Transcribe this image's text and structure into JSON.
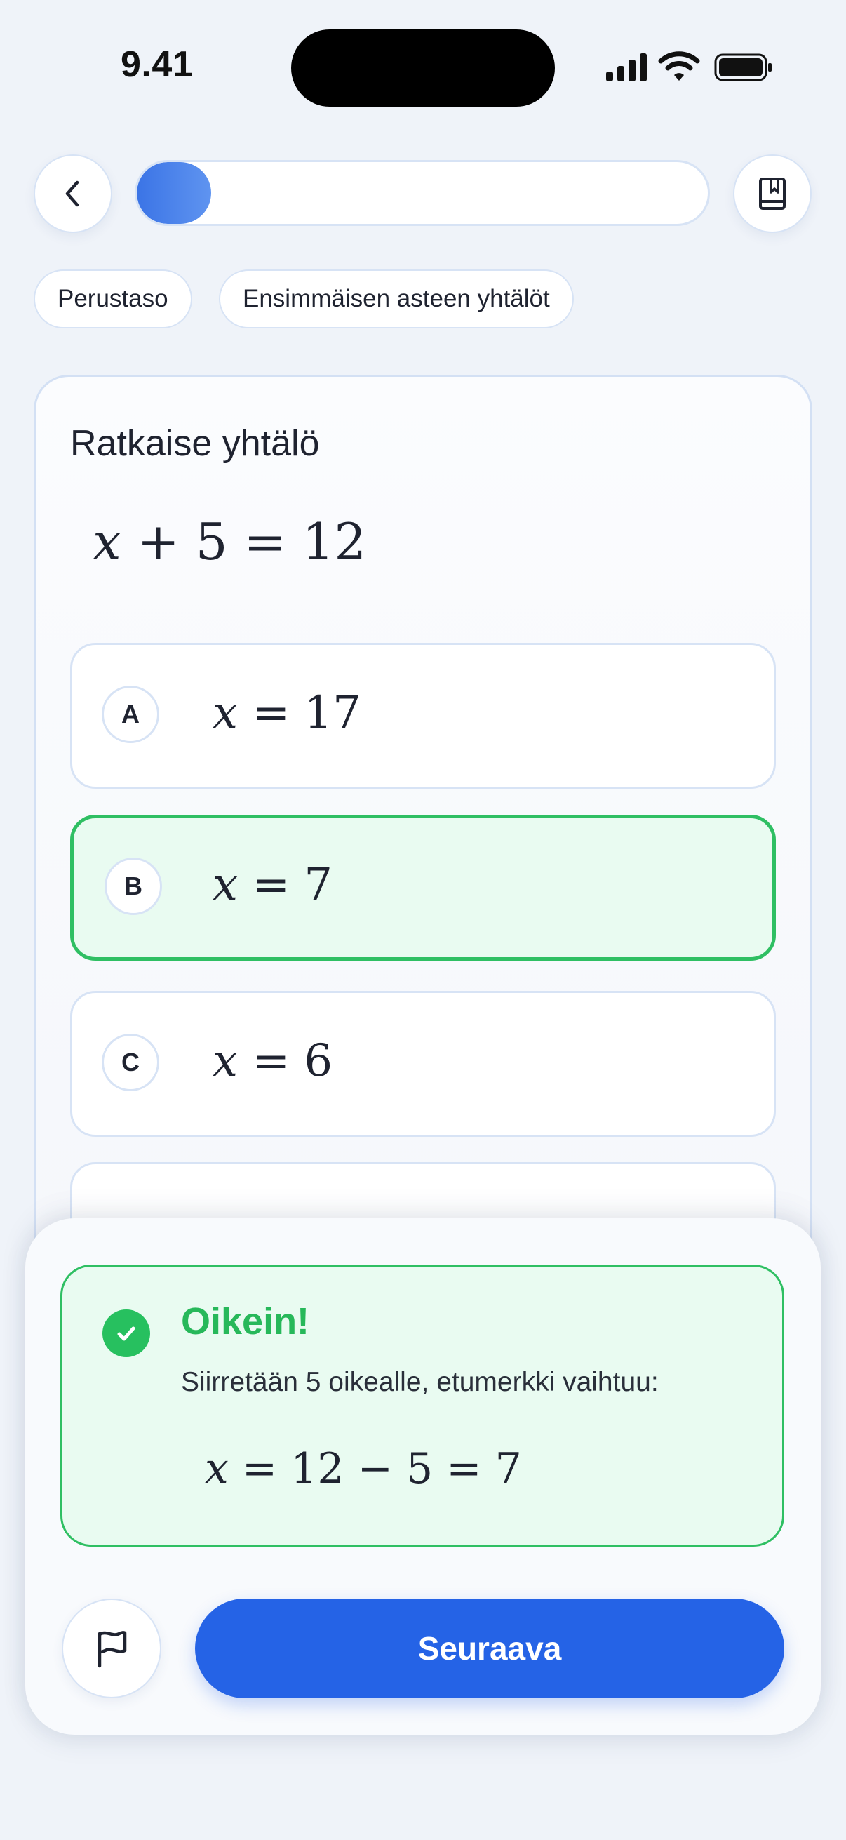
{
  "status_bar": {
    "time": "9.41",
    "icons": [
      "cellular-signal-icon",
      "wifi-icon",
      "battery-icon"
    ]
  },
  "header": {
    "back_icon": "chevron-left-icon",
    "bookmark_icon": "book-icon",
    "progress": 0.13
  },
  "chips": {
    "level": "Perustaso",
    "topic": "Ensimmäisen asteen yhtälöt"
  },
  "question": {
    "prompt": "Ratkaise yhtälö",
    "equation": {
      "var": "x",
      "rest": " + 5 = 12"
    }
  },
  "options": [
    {
      "letter": "A",
      "var": "x",
      "rest": " = 17",
      "state": "default"
    },
    {
      "letter": "B",
      "var": "x",
      "rest": " = 7",
      "state": "correct"
    },
    {
      "letter": "C",
      "var": "x",
      "rest": " = 6",
      "state": "default"
    }
  ],
  "feedback": {
    "icon": "check-circle-icon",
    "title": "Oikein!",
    "text": "Siirretään 5 oikealle, etumerkki vaihtuu:",
    "math": {
      "var": "x",
      "rest": " = 12 − 5 = 7"
    }
  },
  "actions": {
    "flag_icon": "flag-icon",
    "next_label": "Seuraava"
  },
  "colors": {
    "accent": "#2563e6",
    "success": "#2fbf63",
    "success_bg": "#e9fbf1",
    "background": "#eff3f9"
  }
}
